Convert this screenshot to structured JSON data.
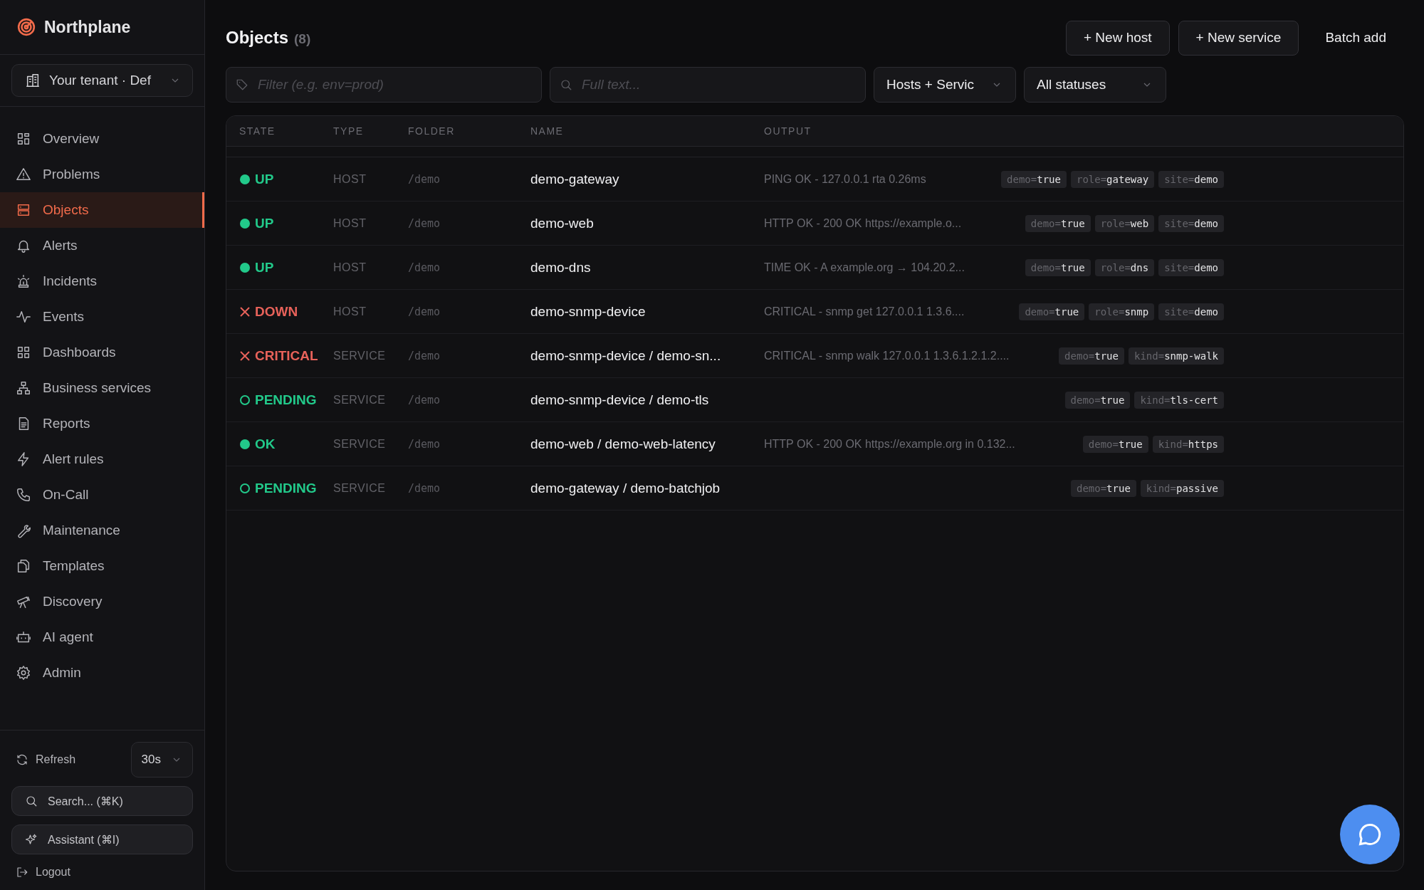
{
  "brand": {
    "name": "Northplane"
  },
  "tenant": {
    "value": "Your tenant · Def"
  },
  "nav": [
    {
      "label": "Overview",
      "selected": false
    },
    {
      "label": "Problems",
      "selected": false
    },
    {
      "label": "Objects",
      "selected": true
    },
    {
      "label": "Alerts",
      "selected": false
    },
    {
      "label": "Incidents",
      "selected": false
    },
    {
      "label": "Events",
      "selected": false
    },
    {
      "label": "Dashboards",
      "selected": false
    },
    {
      "label": "Business services",
      "selected": false
    },
    {
      "label": "Reports",
      "selected": false
    },
    {
      "label": "Alert rules",
      "selected": false
    },
    {
      "label": "On-Call",
      "selected": false
    },
    {
      "label": "Maintenance",
      "selected": false
    },
    {
      "label": "Templates",
      "selected": false
    },
    {
      "label": "Discovery",
      "selected": false
    },
    {
      "label": "AI agent",
      "selected": false
    },
    {
      "label": "Admin",
      "selected": false
    }
  ],
  "footer": {
    "refresh": "Refresh",
    "interval": "30s",
    "search": "Search... (⌘K)",
    "assistant": "Assistant (⌘I)",
    "logout": "Logout"
  },
  "header": {
    "title": "Objects",
    "count": "(8)",
    "buttons": [
      "+ New host",
      "+ New service",
      "Batch add"
    ]
  },
  "filters": {
    "filter_placeholder": "Filter (e.g. env=prod)",
    "search_placeholder": "Full text...",
    "type": "Hosts + Servic",
    "status": "All statuses"
  },
  "table": {
    "columns": [
      "STATE",
      "TYPE",
      "FOLDER",
      "NAME",
      "OUTPUT"
    ],
    "rows": [
      {
        "state": "UP",
        "kind": "dot",
        "color": "#22c98a",
        "type": "HOST",
        "folder": "/demo",
        "name": "demo-gateway",
        "output": "PING OK - 127.0.0.1 rta 0.26ms",
        "tags": [
          {
            "key": "demo=",
            "value": "true"
          },
          {
            "key": "role=",
            "value": "gateway"
          },
          {
            "key": "site=",
            "value": "demo"
          }
        ]
      },
      {
        "state": "UP",
        "kind": "dot",
        "color": "#22c98a",
        "type": "HOST",
        "folder": "/demo",
        "name": "demo-web",
        "output": "HTTP OK - 200 OK https://example.o...",
        "tags": [
          {
            "key": "demo=",
            "value": "true"
          },
          {
            "key": "role=",
            "value": "web"
          },
          {
            "key": "site=",
            "value": "demo"
          }
        ]
      },
      {
        "state": "UP",
        "kind": "dot",
        "color": "#22c98a",
        "type": "HOST",
        "folder": "/demo",
        "name": "demo-dns",
        "output": "TIME OK - A example.org → 104.20.2...",
        "tags": [
          {
            "key": "demo=",
            "value": "true"
          },
          {
            "key": "role=",
            "value": "dns"
          },
          {
            "key": "site=",
            "value": "demo"
          }
        ]
      },
      {
        "state": "DOWN",
        "kind": "cross",
        "color": "#e8625a",
        "type": "HOST",
        "folder": "/demo",
        "name": "demo-snmp-device",
        "output": "CRITICAL - snmp get 127.0.0.1 1.3.6....",
        "tags": [
          {
            "key": "demo=",
            "value": "true"
          },
          {
            "key": "role=",
            "value": "snmp"
          },
          {
            "key": "site=",
            "value": "demo"
          }
        ]
      },
      {
        "state": "CRITICAL",
        "kind": "cross",
        "color": "#e8625a",
        "type": "SERVICE",
        "folder": "/demo",
        "name": "demo-snmp-device / demo-sn...",
        "output": "CRITICAL - snmp walk 127.0.0.1 1.3.6.1.2.1.2....",
        "tags": [
          {
            "key": "demo=",
            "value": "true"
          },
          {
            "key": "kind=",
            "value": "snmp-walk"
          }
        ]
      },
      {
        "state": "PENDING",
        "kind": "ring",
        "color": "#22c98a",
        "type": "SERVICE",
        "folder": "/demo",
        "name": "demo-snmp-device / demo-tls",
        "tags": [
          {
            "key": "demo=",
            "value": "true"
          },
          {
            "key": "kind=",
            "value": "tls-cert"
          }
        ]
      },
      {
        "state": "OK",
        "kind": "dot",
        "color": "#22c98a",
        "type": "SERVICE",
        "folder": "/demo",
        "name": "demo-web / demo-web-latency",
        "output": "HTTP OK - 200 OK https://example.org in 0.132...",
        "tags": [
          {
            "key": "demo=",
            "value": "true"
          },
          {
            "key": "kind=",
            "value": "https"
          }
        ]
      },
      {
        "state": "PENDING",
        "kind": "ring",
        "color": "#22c98a",
        "type": "SERVICE",
        "folder": "/demo",
        "name": "demo-gateway / demo-batchjob",
        "tags": [
          {
            "key": "demo=",
            "value": "true"
          },
          {
            "key": "kind=",
            "value": "passive"
          }
        ]
      }
    ]
  }
}
